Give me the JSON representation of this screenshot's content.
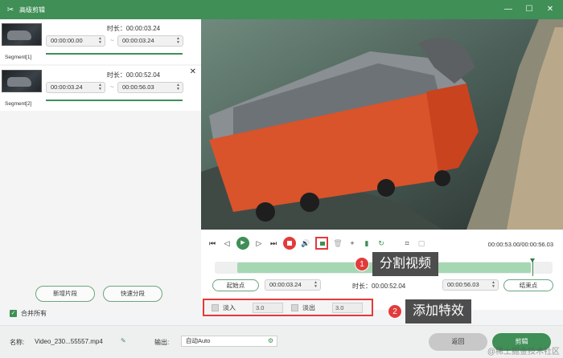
{
  "window": {
    "title": "高级剪辑",
    "controls": {
      "minimize": "—",
      "maximize": "☐",
      "close": "✕"
    }
  },
  "segments": [
    {
      "name": "Segment[1]",
      "duration_label": "时长：00:00:03.24",
      "start": "00:00:00.00",
      "end": "00:00:03.24",
      "progress": 1.0
    },
    {
      "name": "Segment[2]",
      "duration_label": "时长：00:00:52.04",
      "start": "00:00:03.24",
      "end": "00:00:56.03",
      "progress": 1.0
    }
  ],
  "segment_separator": "~",
  "left_buttons": {
    "add_segment": "新增片段",
    "quick_split": "快速分段"
  },
  "merge_all": {
    "label": "合并所有",
    "checked": true
  },
  "player": {
    "time_display": "00:00:53.00/00:00:56.03",
    "timeline_position": 0.94
  },
  "range": {
    "start_button": "起始点",
    "start_value": "00:00:03.24",
    "duration_label": "时长：00:00:52.04",
    "end_value": "00:00:56.03",
    "end_button": "结束点"
  },
  "effects": {
    "fade_in": {
      "label": "淡入",
      "value": "3.0",
      "checked": false
    },
    "fade_out": {
      "label": "淡出",
      "value": "3.0",
      "checked": false
    }
  },
  "callouts": [
    {
      "number": "1",
      "text": "分割视频"
    },
    {
      "number": "2",
      "text": "添加特效"
    }
  ],
  "bottom": {
    "name_label": "名称:",
    "name_value": "Video_230...55557.mp4",
    "output_label": "输出:",
    "output_value": "自动Auto",
    "back_button": "返回",
    "cut_button": "剪辑"
  },
  "watermark": "@稀土掘金技术社区",
  "colors": {
    "brand_green": "#3f8f57",
    "highlight_red": "#e23b3b"
  },
  "icons": [
    "app-logo-icon",
    "minimize-icon",
    "maximize-icon",
    "close-icon",
    "skip-start-icon",
    "prev-frame-icon",
    "play-icon",
    "next-frame-icon",
    "skip-end-icon",
    "stop-icon",
    "volume-icon",
    "split-icon",
    "delete-icon",
    "add-icon",
    "trash-icon",
    "rotate-icon",
    "crop-icon",
    "snapshot-icon",
    "edit-icon",
    "gear-icon"
  ]
}
